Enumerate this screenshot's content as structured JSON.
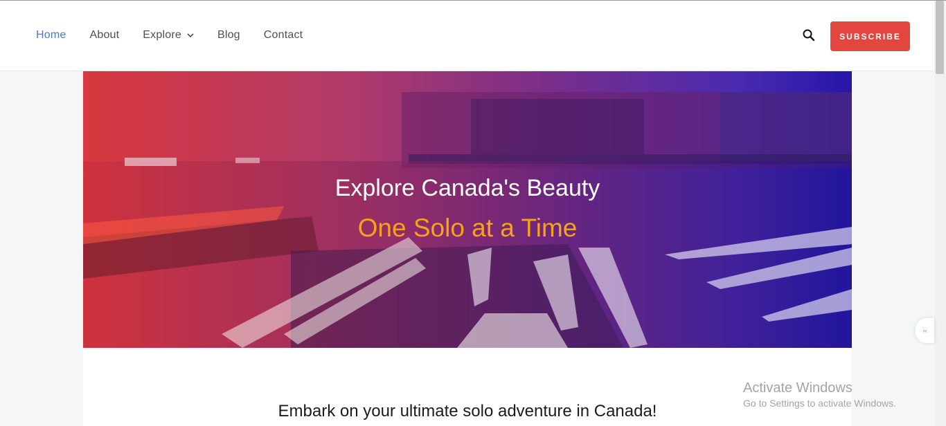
{
  "nav": {
    "items": [
      {
        "label": "Home",
        "active": true
      },
      {
        "label": "About"
      },
      {
        "label": "Explore",
        "dropdown": true
      },
      {
        "label": "Blog"
      },
      {
        "label": "Contact"
      }
    ]
  },
  "header": {
    "subscribe_label": "SUBSCRIBE",
    "search_icon": "search-icon"
  },
  "hero": {
    "title": "Explore Canada's Beauty",
    "subtitle": "One Solo at a Time"
  },
  "content": {
    "lead": "Embark on your ultimate solo adventure in Canada!"
  },
  "watermark": {
    "title": "Activate Windows",
    "subtitle": "Go to Settings to activate Windows."
  },
  "colors": {
    "accent": "#e2463f",
    "nav_active": "#4a7bd0",
    "hero_subtitle": "#f7a21b"
  }
}
